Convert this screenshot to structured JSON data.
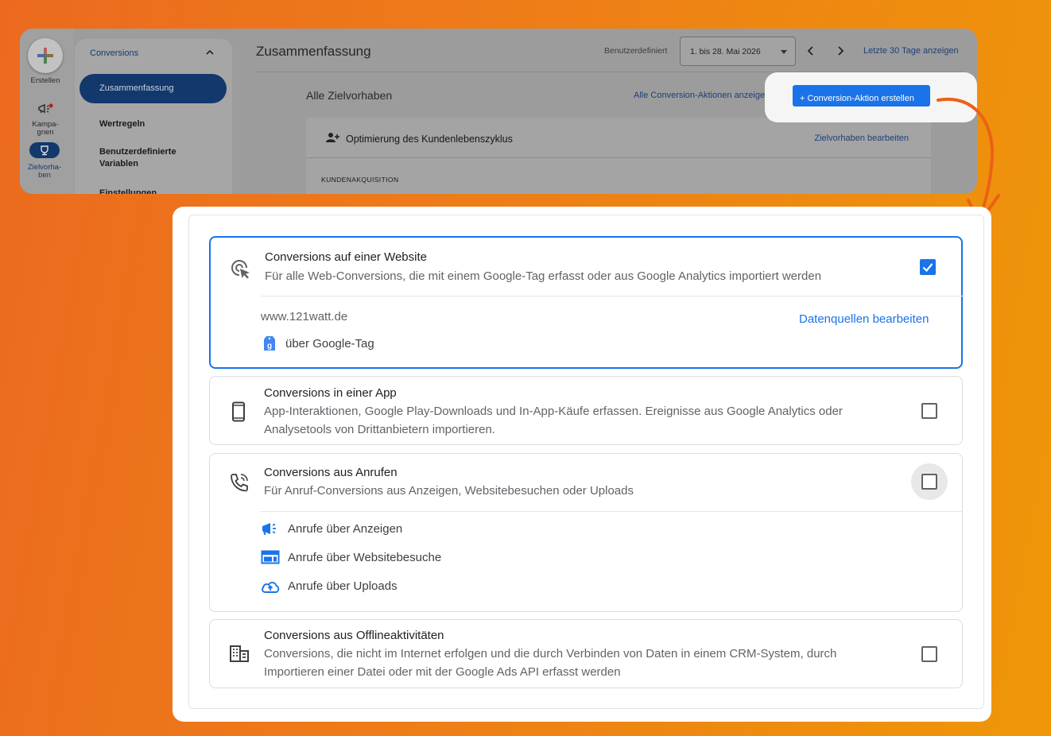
{
  "rail": {
    "create_label": "Erstellen",
    "campaigns_label": "Kampa-\ngnen",
    "goals_label": "Zielvorha-\nben"
  },
  "nav": {
    "section": "Conversions",
    "active": "Zusammenfassung",
    "items": [
      "Wertregeln",
      "Benutzerdefinierte Variablen",
      "Einstellungen"
    ]
  },
  "header": {
    "title": "Zusammenfassung",
    "range_label": "Benutzerdefiniert",
    "range_value": "1. bis 28. Mai 2026",
    "last30": "Letzte 30 Tage anzeigen"
  },
  "goals": {
    "title": "Alle Zielvorhaben",
    "all_actions": "Alle Conversion-Aktionen anzeigen",
    "create_button": "+ Conversion-Aktion erstellen",
    "card_title": "Optimierung des Kundenlebenszyklus",
    "card_edit": "Zielvorhaben bearbeiten",
    "card_section": "KUNDENAKQUISITION"
  },
  "modal": {
    "website": {
      "title": "Conversions auf einer Website",
      "desc": "Für alle Web-Conversions, die mit einem Google-Tag erfasst oder aus Google Analytics importiert werden",
      "domain": "www.121watt.de",
      "edit_sources": "Datenquellen bearbeiten",
      "via": "über Google-Tag",
      "checked": true
    },
    "app": {
      "title": "Conversions in einer App",
      "desc": "App-Interaktionen, Google Play-Downloads und In-App-Käufe erfassen. Ereignisse aus Google Analytics oder Analysetools von Drittanbietern importieren.",
      "checked": false
    },
    "calls": {
      "title": "Conversions aus Anrufen",
      "desc": "Für Anruf-Conversions aus Anzeigen, Websitebesuchen oder Uploads",
      "items": [
        "Anrufe über Anzeigen",
        "Anrufe über Websitebesuche",
        "Anrufe über Uploads"
      ],
      "checked": false
    },
    "offline": {
      "title": "Conversions aus Offlineaktivitäten",
      "desc": "Conversions, die nicht im Internet erfolgen und die durch Verbinden von Daten in einem CRM-System, durch Importieren einer Datei oder mit der Google Ads API erfasst werden",
      "checked": false
    }
  },
  "colors": {
    "accent": "#1a73e8",
    "brand_orange": "#ee7d18"
  }
}
